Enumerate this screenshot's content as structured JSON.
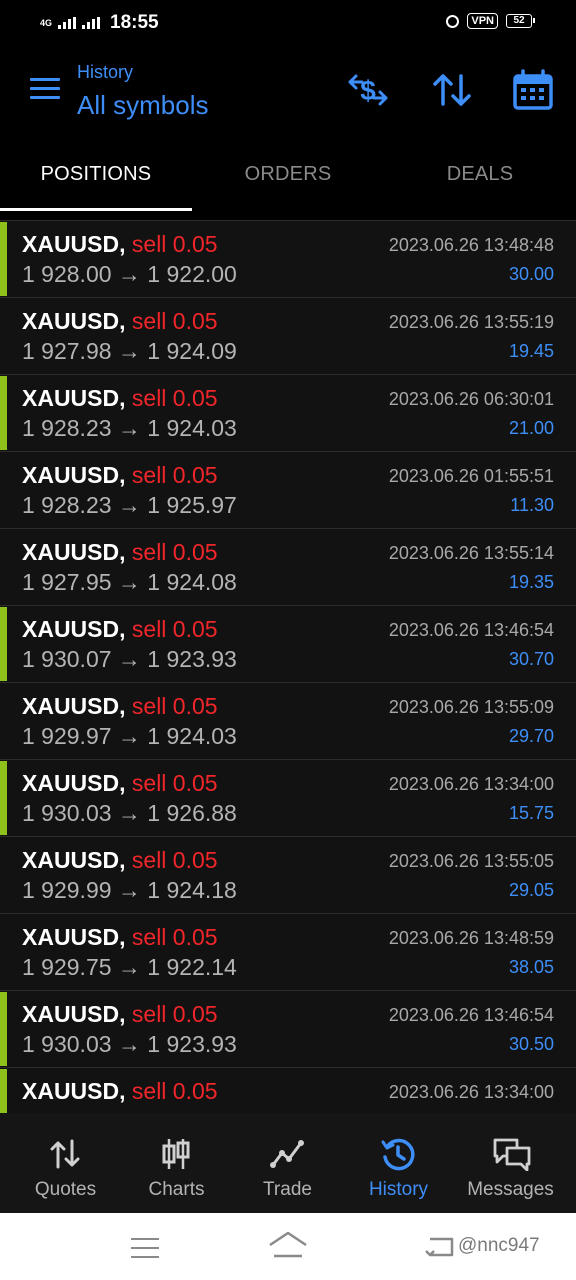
{
  "status_bar": {
    "network": "4G",
    "time": "18:55",
    "vpn": "VPN",
    "battery": "52"
  },
  "header": {
    "subtitle": "History",
    "title": "All symbols",
    "icons": [
      "exchange-dollar-icon",
      "sort-arrows-icon",
      "calendar-icon"
    ]
  },
  "tabs": [
    {
      "label": "POSITIONS",
      "active": true
    },
    {
      "label": "ORDERS",
      "active": false
    },
    {
      "label": "DEALS",
      "active": false
    }
  ],
  "positions": [
    {
      "symbol": "XAUUSD,",
      "side": "sell 0.05",
      "prices": "1 928.00 → 1 922.00",
      "time": "2023.06.26 13:48:48",
      "profit": "30.00",
      "marker": true
    },
    {
      "symbol": "XAUUSD,",
      "side": "sell 0.05",
      "prices": "1 927.98 → 1 924.09",
      "time": "2023.06.26 13:55:19",
      "profit": "19.45",
      "marker": false
    },
    {
      "symbol": "XAUUSD,",
      "side": "sell 0.05",
      "prices": "1 928.23 → 1 924.03",
      "time": "2023.06.26 06:30:01",
      "profit": "21.00",
      "marker": true
    },
    {
      "symbol": "XAUUSD,",
      "side": "sell 0.05",
      "prices": "1 928.23 → 1 925.97",
      "time": "2023.06.26 01:55:51",
      "profit": "11.30",
      "marker": false
    },
    {
      "symbol": "XAUUSD,",
      "side": "sell 0.05",
      "prices": "1 927.95 → 1 924.08",
      "time": "2023.06.26 13:55:14",
      "profit": "19.35",
      "marker": false
    },
    {
      "symbol": "XAUUSD,",
      "side": "sell 0.05",
      "prices": "1 930.07 → 1 923.93",
      "time": "2023.06.26 13:46:54",
      "profit": "30.70",
      "marker": true
    },
    {
      "symbol": "XAUUSD,",
      "side": "sell 0.05",
      "prices": "1 929.97 → 1 924.03",
      "time": "2023.06.26 13:55:09",
      "profit": "29.70",
      "marker": false
    },
    {
      "symbol": "XAUUSD,",
      "side": "sell 0.05",
      "prices": "1 930.03 → 1 926.88",
      "time": "2023.06.26 13:34:00",
      "profit": "15.75",
      "marker": true
    },
    {
      "symbol": "XAUUSD,",
      "side": "sell 0.05",
      "prices": "1 929.99 → 1 924.18",
      "time": "2023.06.26 13:55:05",
      "profit": "29.05",
      "marker": false
    },
    {
      "symbol": "XAUUSD,",
      "side": "sell 0.05",
      "prices": "1 929.75 → 1 922.14",
      "time": "2023.06.26 13:48:59",
      "profit": "38.05",
      "marker": false
    },
    {
      "symbol": "XAUUSD,",
      "side": "sell 0.05",
      "prices": "1 930.03 → 1 923.93",
      "time": "2023.06.26 13:46:54",
      "profit": "30.50",
      "marker": true
    },
    {
      "symbol": "XAUUSD,",
      "side": "sell 0.05",
      "prices": "",
      "time": "2023.06.26 13:34:00",
      "profit": "",
      "marker": true
    }
  ],
  "bottom_nav": [
    {
      "label": "Quotes",
      "icon": "quotes-arrows-icon",
      "active": false
    },
    {
      "label": "Charts",
      "icon": "candlestick-icon",
      "active": false
    },
    {
      "label": "Trade",
      "icon": "trade-line-icon",
      "active": false
    },
    {
      "label": "History",
      "icon": "history-clock-icon",
      "active": true
    },
    {
      "label": "Messages",
      "icon": "messages-icon",
      "active": false
    }
  ],
  "system_nav": {
    "watermark": "@nnc947"
  },
  "colors": {
    "accent": "#3e8ef7",
    "sell": "#f0262a",
    "marker": "#8ec21a",
    "background": "#000000"
  }
}
